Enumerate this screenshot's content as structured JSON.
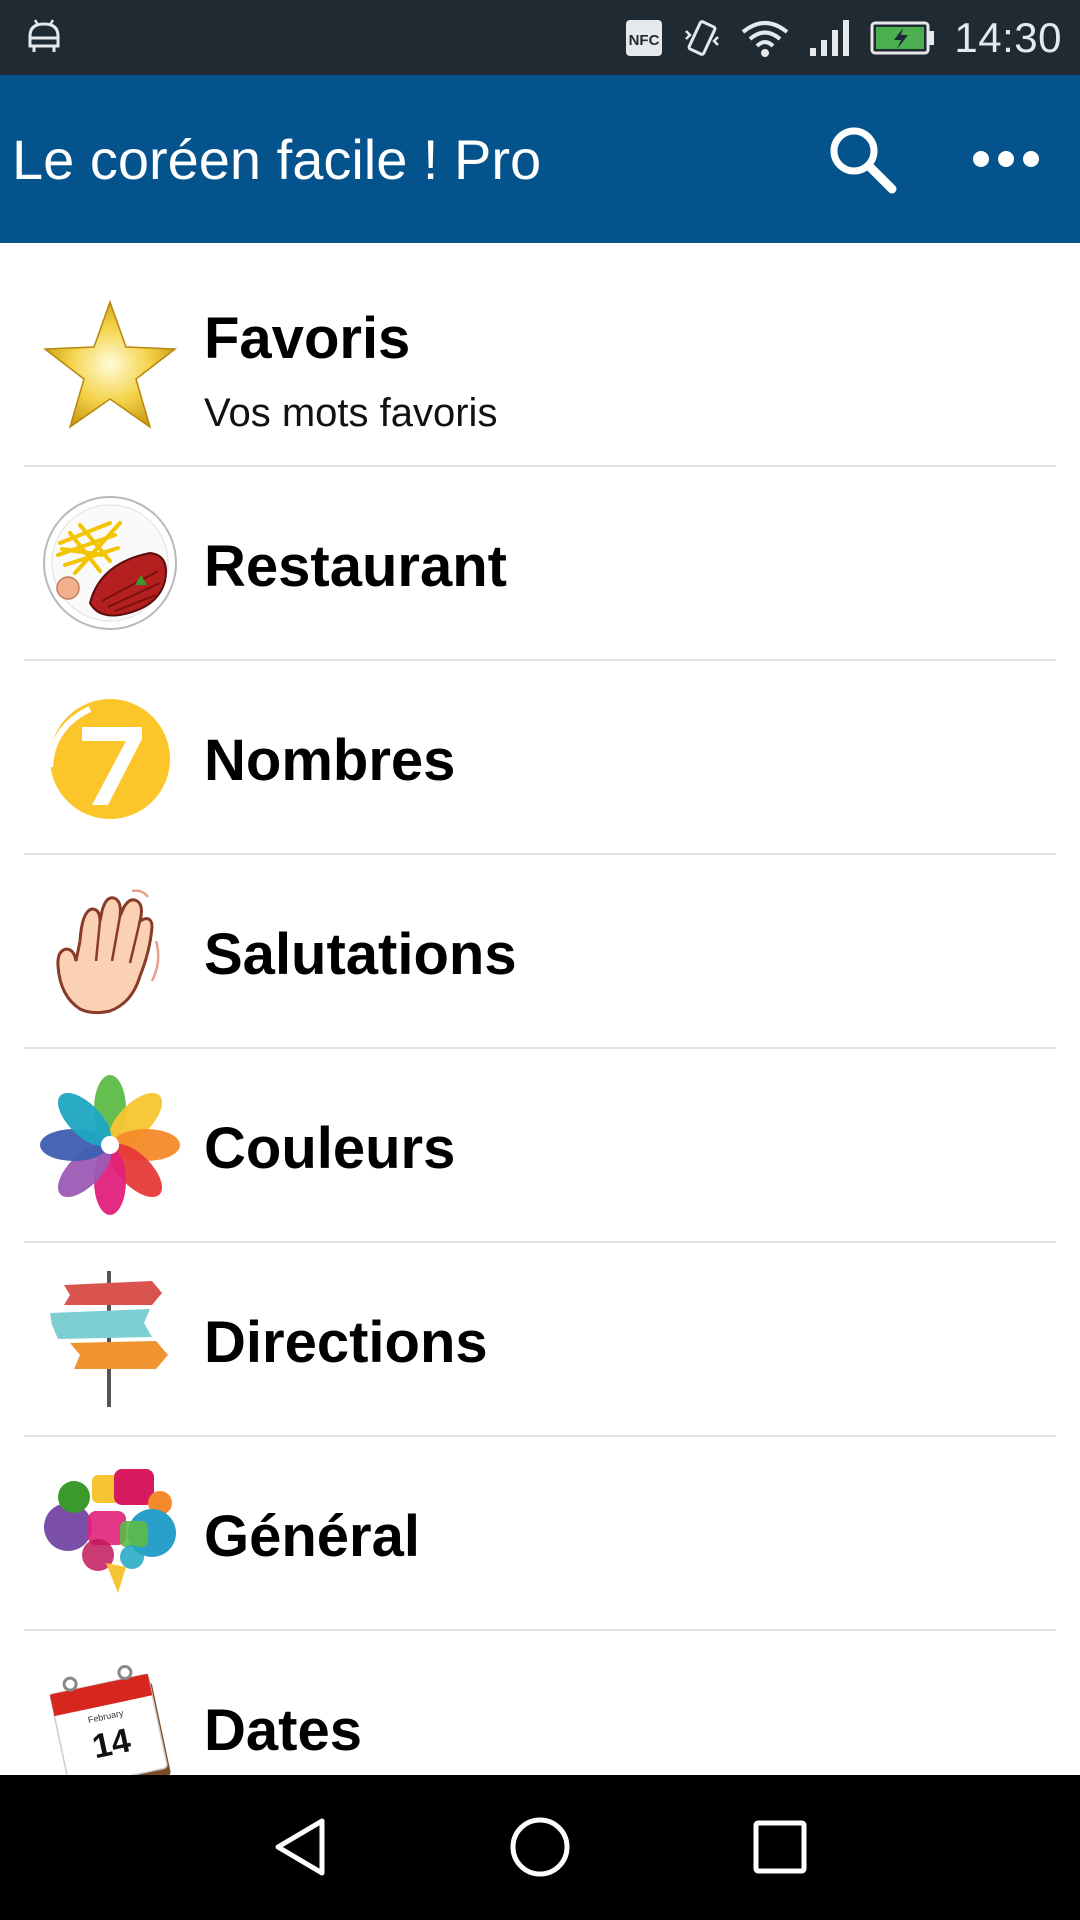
{
  "status_bar": {
    "left_icon": "android-debug-icon",
    "nfc_label": "NFC",
    "icons": [
      "nfc-icon",
      "vibrate-icon",
      "wifi-icon",
      "signal-icon",
      "battery-charging-icon"
    ],
    "time": "14:30"
  },
  "app_bar": {
    "title": "Le coréen facile ! Pro",
    "search_icon": "search-icon",
    "more_icon": "more-options-icon",
    "color": "#04538c"
  },
  "list": {
    "items": [
      {
        "title": "Favoris",
        "subtitle": "Vos mots favoris",
        "icon": "star-icon"
      },
      {
        "title": "Restaurant",
        "icon": "food-plate-icon"
      },
      {
        "title": "Nombres",
        "icon": "number-seven-icon"
      },
      {
        "title": "Salutations",
        "icon": "waving-hand-icon"
      },
      {
        "title": "Couleurs",
        "icon": "color-flower-icon"
      },
      {
        "title": "Directions",
        "icon": "signpost-icon"
      },
      {
        "title": "Général",
        "icon": "speech-bubbles-icon"
      },
      {
        "title": "Dates",
        "icon": "calendar-icon",
        "calendar_month": "February",
        "calendar_day": "14"
      }
    ]
  },
  "nav_bar": {
    "back_icon": "back-icon",
    "home_icon": "home-icon",
    "recents_icon": "recents-icon"
  }
}
